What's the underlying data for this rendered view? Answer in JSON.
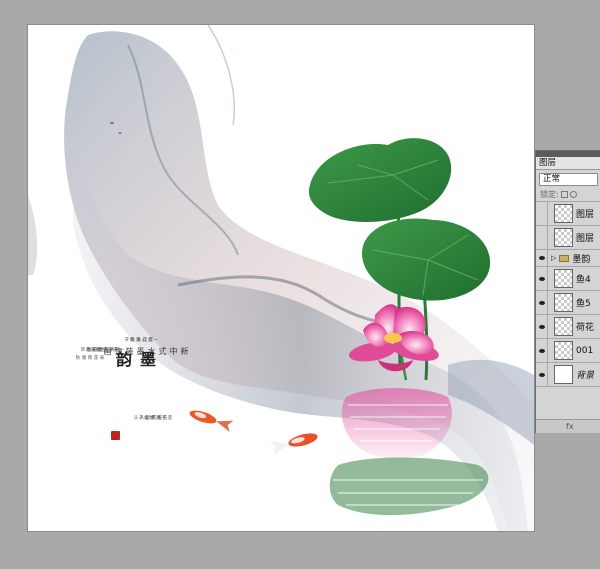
{
  "poem": {
    "title_chars": [
      "墨",
      "韵"
    ],
    "subtitle_chars": [
      "新",
      "中",
      "式",
      "水",
      "墨",
      "装",
      "饰",
      "画"
    ],
    "verse_columns": [
      "一念心清静",
      "莲花处处开",
      "一花一世界",
      "一叶一如来",
      "清水出芙蓉",
      "天然去雕饰",
      "采莲南塘秋",
      "莲花过人头",
      "低头弄莲子",
      "莲子清如水"
    ]
  },
  "layers_panel": {
    "tab_label": "图层",
    "blend_mode": "正常",
    "lock_label": "锁定:",
    "layers": [
      {
        "name": "图层",
        "visible": false,
        "type": "layer"
      },
      {
        "name": "图层",
        "visible": false,
        "type": "layer"
      },
      {
        "name": "墨韵",
        "visible": true,
        "type": "group"
      },
      {
        "name": "鱼4",
        "visible": true,
        "type": "layer"
      },
      {
        "name": "鱼5",
        "visible": true,
        "type": "layer"
      },
      {
        "name": "荷花",
        "visible": true,
        "type": "layer"
      },
      {
        "name": "001",
        "visible": true,
        "type": "layer"
      },
      {
        "name": "背景",
        "visible": true,
        "type": "background"
      }
    ],
    "bottom_label": "fx"
  }
}
